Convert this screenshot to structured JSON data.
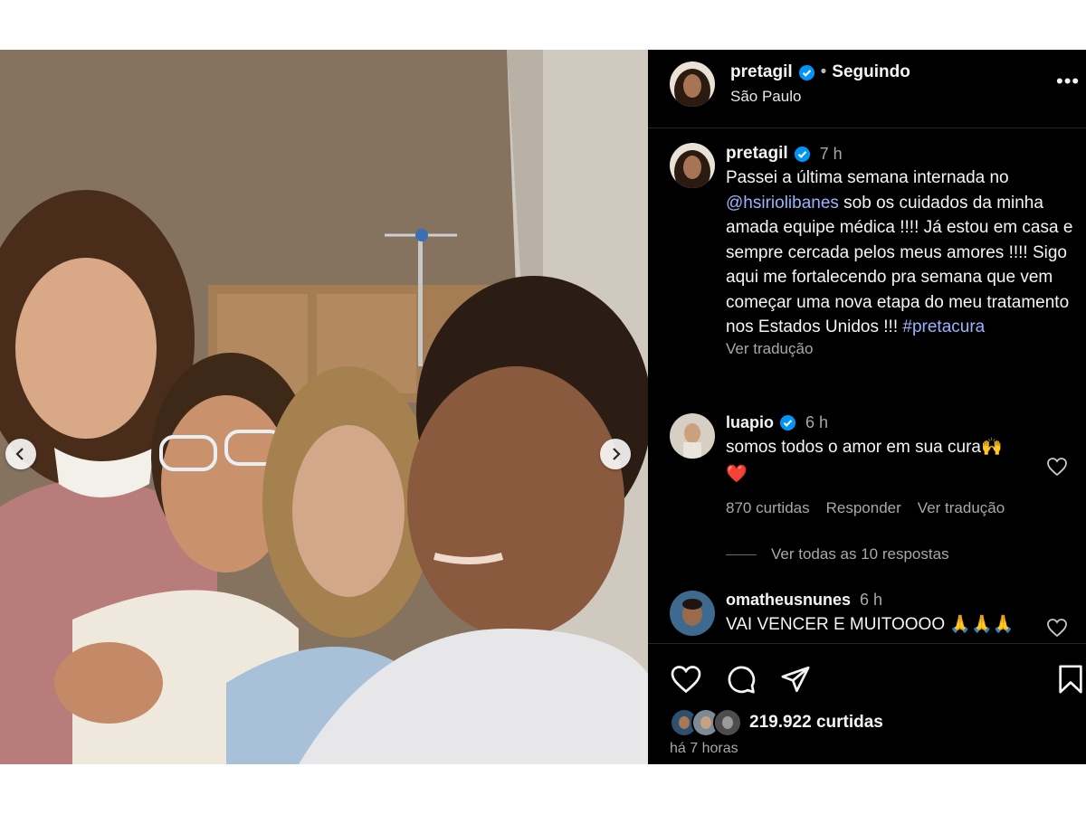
{
  "header": {
    "username": "pretagil",
    "separator": "•",
    "follow_status": "Seguindo",
    "location": "São Paulo",
    "more": "•••"
  },
  "caption": {
    "username": "pretagil",
    "time": "7 h",
    "text_before": "Passei a última semana internada no ",
    "mention": "@hsiriolibanes",
    "text_after": " sob os cuidados da minha amada equipe médica !!!! Já estou em casa e sempre cercada pelos meus amores !!!! Sigo aqui me fortalecendo pra semana que vem começar uma nova etapa do meu tratamento nos Estados Unidos !!! ",
    "hashtag": "#pretacura",
    "see_translation": "Ver tradução"
  },
  "comments": [
    {
      "username": "luapio",
      "time": "6 h",
      "text": "somos todos o amor em sua cura🙌",
      "emoji_line": "❤️",
      "likes": "870 curtidas",
      "reply": "Responder",
      "see_translation": "Ver tradução",
      "view_replies": "Ver todas as 10 respostas"
    },
    {
      "username": "omatheusnunes",
      "time": "6 h",
      "text": "VAI VENCER E MUITOOOO 🙏🙏🙏"
    }
  ],
  "footer": {
    "likes": "219.922 curtidas",
    "posted": "há 7 horas"
  },
  "icons": {
    "verified": "verified-badge-icon",
    "heart": "heart-icon",
    "comment": "comment-icon",
    "share": "share-icon",
    "save": "bookmark-icon",
    "prev": "chevron-left-icon",
    "next": "chevron-right-icon"
  },
  "colors": {
    "background": "#000000",
    "verified": "#0095f6",
    "link": "#9bb3ff",
    "muted": "#a8a8a8"
  }
}
